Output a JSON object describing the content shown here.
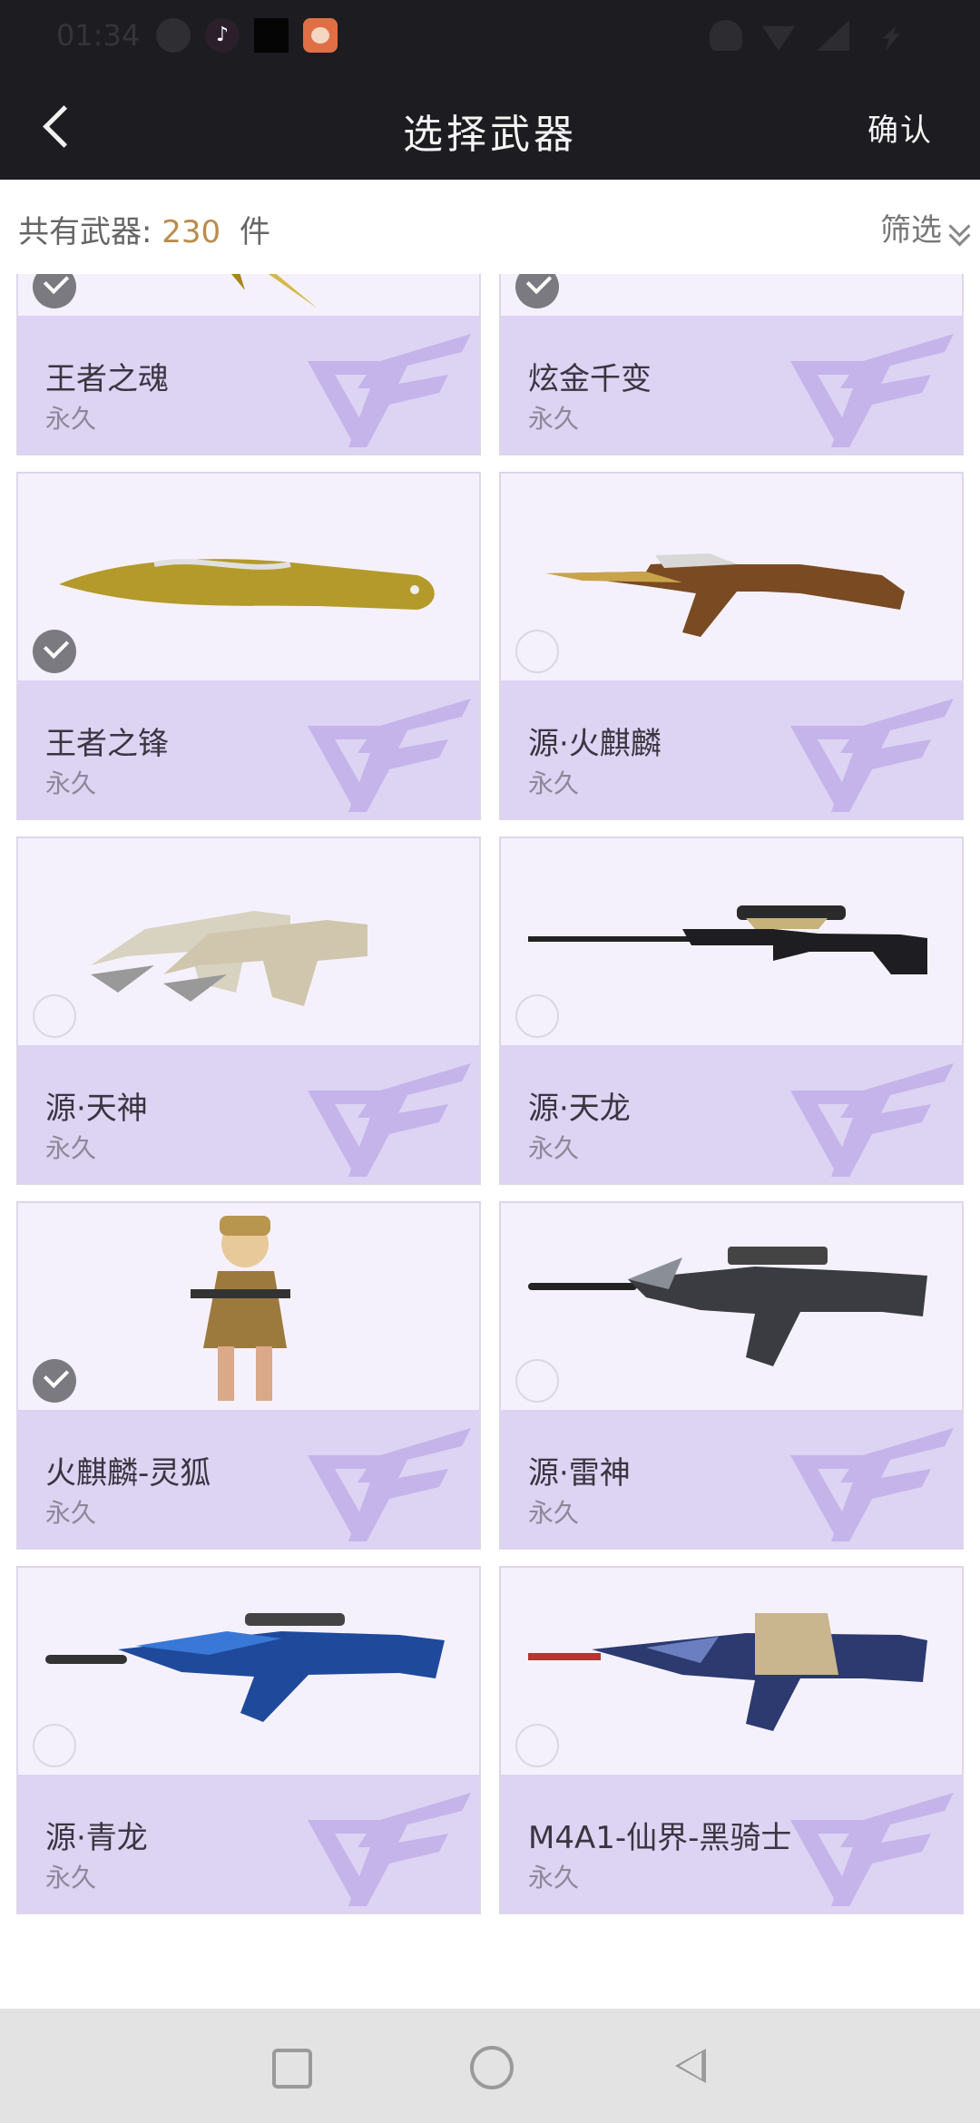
{
  "status_bar": {
    "time": "01:34"
  },
  "header": {
    "title": "选择武器",
    "confirm_label": "确认"
  },
  "summary": {
    "count_label": "共有武器:",
    "count_value": "230",
    "count_unit": "件",
    "filter_label": "筛选"
  },
  "weapons": [
    {
      "name": "王者之魂",
      "duration": "永久",
      "selected": true,
      "icon": "golden-pistol-icon"
    },
    {
      "name": "炫金千变",
      "duration": "永久",
      "selected": true,
      "icon": "golden-rifle-icon"
    },
    {
      "name": "王者之锋",
      "duration": "永久",
      "selected": true,
      "icon": "golden-knife-icon"
    },
    {
      "name": "源·火麒麟",
      "duration": "永久",
      "selected": false,
      "icon": "ak-rifle-icon"
    },
    {
      "name": "源·天神",
      "duration": "永久",
      "selected": false,
      "icon": "dual-pistols-icon"
    },
    {
      "name": "源·天龙",
      "duration": "永久",
      "selected": false,
      "icon": "sniper-rifle-icon"
    },
    {
      "name": "火麒麟-灵狐",
      "duration": "永久",
      "selected": true,
      "icon": "character-icon"
    },
    {
      "name": "源·雷神",
      "duration": "永久",
      "selected": false,
      "icon": "m4-rifle-icon"
    },
    {
      "name": "源·青龙",
      "duration": "永久",
      "selected": false,
      "icon": "blue-rifle-icon"
    },
    {
      "name": "M4A1-仙界-黑骑士",
      "duration": "永久",
      "selected": false,
      "icon": "black-knight-rifle-icon"
    }
  ],
  "colors": {
    "accent": "#b98c4e",
    "header_bg": "#1d1d21",
    "card_bg": "#f5f1fc",
    "card_info_bg": "#ddd3f3"
  }
}
